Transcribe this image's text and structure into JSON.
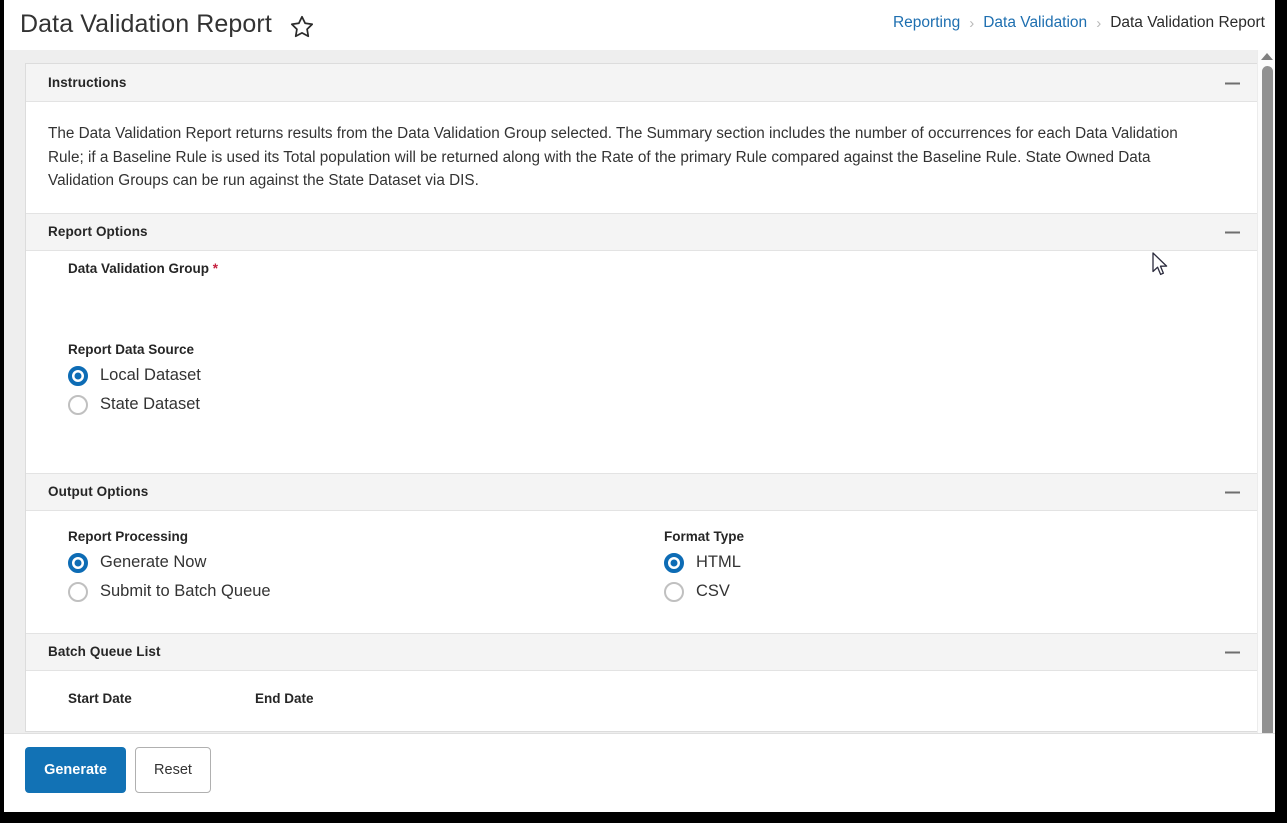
{
  "header": {
    "title": "Data Validation Report",
    "favorite_icon": "star-icon",
    "breadcrumb": {
      "items": [
        {
          "label": "Reporting",
          "link": true
        },
        {
          "label": "Data Validation",
          "link": true
        },
        {
          "label": "Data Validation Report",
          "link": false
        }
      ],
      "separator": "›"
    }
  },
  "sections": {
    "instructions": {
      "title": "Instructions",
      "collapse_icon": "minus-icon",
      "body": "The Data Validation Report returns results from the Data Validation Group selected. The Summary section includes the number of occurrences for each Data Validation Rule; if a Baseline Rule is used its Total population will be returned along with the Rate of the primary Rule compared against the Baseline Rule. State Owned Data Validation Groups can be run against the State Dataset via DIS."
    },
    "report_options": {
      "title": "Report Options",
      "collapse_icon": "minus-icon",
      "data_validation_group": {
        "label": "Data Validation Group",
        "required_marker": "*",
        "value": "",
        "caret_icon": "chevron-down-icon",
        "options": []
      },
      "report_data_source": {
        "label": "Report Data Source",
        "selected": "Local Dataset",
        "options": [
          {
            "label": "Local Dataset",
            "checked": true
          },
          {
            "label": "State Dataset",
            "checked": false
          }
        ]
      }
    },
    "output_options": {
      "title": "Output Options",
      "collapse_icon": "minus-icon",
      "report_processing": {
        "label": "Report Processing",
        "selected": "Generate Now",
        "options": [
          {
            "label": "Generate Now",
            "checked": true
          },
          {
            "label": "Submit to Batch Queue",
            "checked": false
          }
        ]
      },
      "format_type": {
        "label": "Format Type",
        "selected": "HTML",
        "options": [
          {
            "label": "HTML",
            "checked": true
          },
          {
            "label": "CSV",
            "checked": false
          }
        ]
      }
    },
    "batch_queue_list": {
      "title": "Batch Queue List",
      "collapse_icon": "minus-icon",
      "columns": [
        "Start Date",
        "End Date"
      ],
      "rows": []
    }
  },
  "footer": {
    "generate_label": "Generate",
    "reset_label": "Reset"
  },
  "colors": {
    "accent_blue": "#1272b5",
    "link_blue": "#1e6fb0",
    "radio_blue": "#0d6cb5",
    "required_red": "#c5203f",
    "section_header_bg": "#f4f4f4",
    "app_bg": "#eeeeee"
  },
  "scrollbar": {
    "up_arrow_icon": "chevron-up-icon",
    "position": "top"
  }
}
